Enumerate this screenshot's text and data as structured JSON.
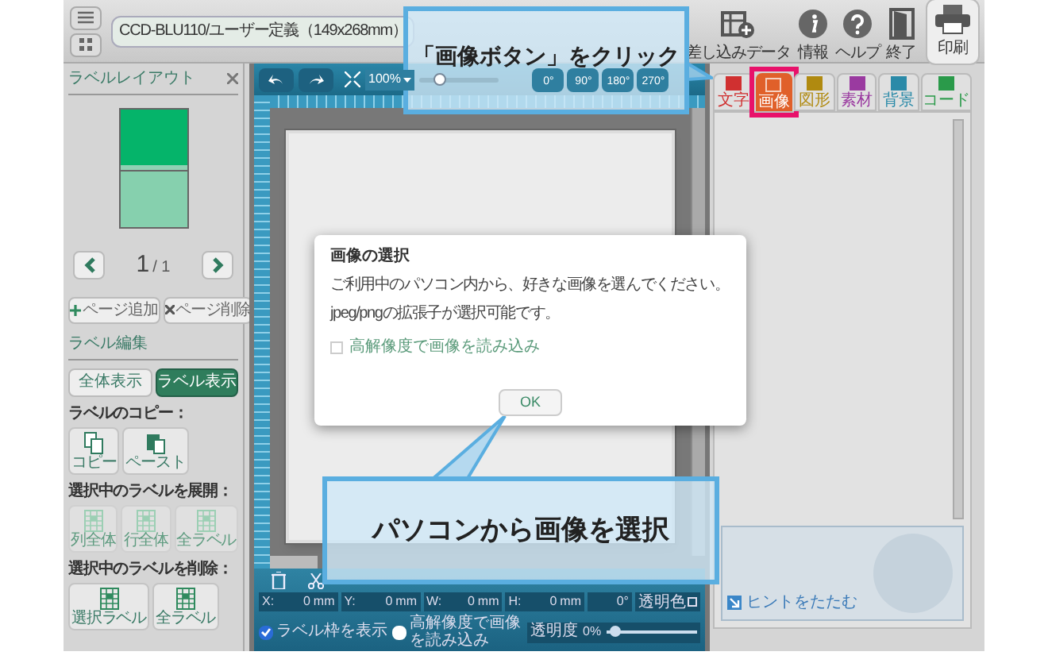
{
  "toolbar": {
    "document_title": "CCD-BLU110/ユーザー定義（149x268mm）",
    "buttons": [
      {
        "kind": "merge",
        "label": "差し込みデータ"
      },
      {
        "kind": "info",
        "label": "情報"
      },
      {
        "kind": "help",
        "label": "ヘルプ"
      },
      {
        "kind": "exit",
        "label": "終了"
      },
      {
        "kind": "print",
        "label": "印刷"
      }
    ]
  },
  "left_panel": {
    "title": "ラベルレイアウト",
    "page_current": "1",
    "page_total": "/ 1",
    "page_buttons": [
      {
        "kind": "add",
        "label": "ページ追加"
      },
      {
        "kind": "delete",
        "label": "ページ削除"
      }
    ],
    "edit_heading": "ラベル編集",
    "view_buttons": [
      {
        "label": "全体表示",
        "selected": false
      },
      {
        "label": "ラベル表示",
        "selected": true
      }
    ],
    "groups": [
      {
        "heading": "ラベルのコピー：",
        "buttons": [
          {
            "kind": "copy",
            "label": "コピー",
            "disabled": false
          },
          {
            "kind": "paste",
            "label": "ペースト",
            "disabled": false
          }
        ]
      },
      {
        "heading": "選択中のラベルを展開：",
        "buttons": [
          {
            "kind": "grid",
            "label": "列全体",
            "disabled": true
          },
          {
            "kind": "grid",
            "label": "行全体",
            "disabled": true
          },
          {
            "kind": "grid",
            "label": "全ラベル",
            "disabled": true
          }
        ]
      },
      {
        "heading": "選択中のラベルを削除：",
        "buttons": [
          {
            "kind": "grid",
            "label": "選択ラベル",
            "disabled": false
          },
          {
            "kind": "grid",
            "label": "全ラベル",
            "disabled": false
          }
        ]
      }
    ]
  },
  "canvas": {
    "zoom": "100%",
    "zoom_level": {
      "level": 0.25
    },
    "rotate_buttons": [
      "0°",
      "90°",
      "180°",
      "270°"
    ]
  },
  "properties": {
    "fields": [
      {
        "label": "X:",
        "value": "0",
        "unit": "mm"
      },
      {
        "label": "Y:",
        "value": "0",
        "unit": "mm"
      },
      {
        "label": "W:",
        "value": "0",
        "unit": "mm"
      },
      {
        "label": "H:",
        "value": "0",
        "unit": "mm"
      }
    ],
    "rotation": "0°",
    "transparent_color": "透明色",
    "checkboxes": [
      {
        "label": "ラベル枠を表示",
        "checked": true
      },
      {
        "label": "高解像度で画像を読み込み",
        "checked": false
      }
    ],
    "opacity": {
      "label": "透明度",
      "value": "0%",
      "level": 0.1
    }
  },
  "right_panel": {
    "tabs": [
      {
        "label": "文字",
        "selected": false,
        "color": "#d03030"
      },
      {
        "label": "画像",
        "selected": true,
        "color": "#e0602a"
      },
      {
        "label": "図形",
        "selected": false,
        "color": "#b08a10"
      },
      {
        "label": "素材",
        "selected": false,
        "color": "#9a3aa0"
      },
      {
        "label": "背景",
        "selected": false,
        "color": "#2a8aa8"
      },
      {
        "label": "コード",
        "selected": false,
        "color": "#2a9a4a"
      }
    ],
    "hint_toggle": "ヒントをたたむ"
  },
  "dialog": {
    "title": "画像の選択",
    "message_lines": [
      "ご利用中のパソコン内から、好きな画像を選んでください。",
      "jpeg/pngの拡張子が選択可能です。"
    ],
    "checkbox": {
      "label": "高解像度で画像を読み込み",
      "checked": false
    },
    "button": "OK"
  },
  "callouts": [
    {
      "text": "「画像ボタン」をクリック"
    },
    {
      "text": "パソコンから画像を選択"
    }
  ]
}
